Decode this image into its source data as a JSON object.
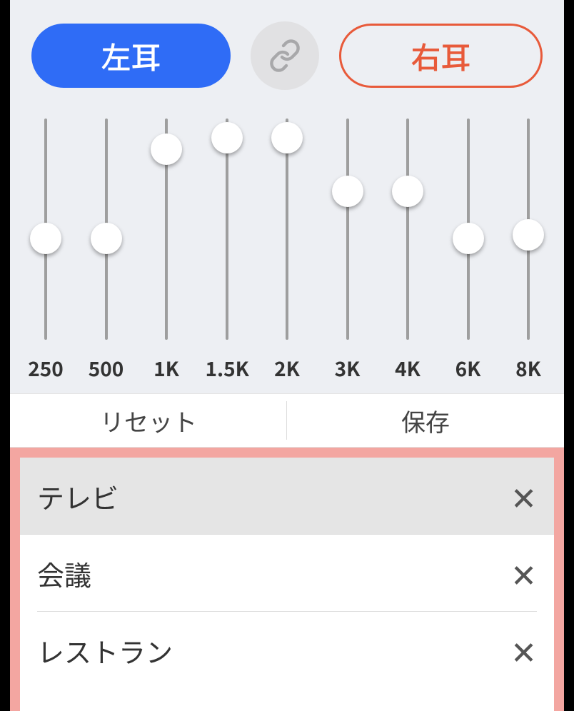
{
  "ears": {
    "left_label": "左耳",
    "right_label": "右耳",
    "selected": "left"
  },
  "equalizer": {
    "bands": [
      {
        "freq": "250",
        "value": 45
      },
      {
        "freq": "500",
        "value": 45
      },
      {
        "freq": "1K",
        "value": 92
      },
      {
        "freq": "1.5K",
        "value": 98
      },
      {
        "freq": "2K",
        "value": 98
      },
      {
        "freq": "3K",
        "value": 70
      },
      {
        "freq": "4K",
        "value": 70
      },
      {
        "freq": "6K",
        "value": 45
      },
      {
        "freq": "8K",
        "value": 47
      }
    ],
    "reset_label": "リセット",
    "save_label": "保存"
  },
  "presets": [
    {
      "name": "テレビ",
      "selected": true
    },
    {
      "name": "会議",
      "selected": false
    },
    {
      "name": "レストラン",
      "selected": false
    }
  ]
}
